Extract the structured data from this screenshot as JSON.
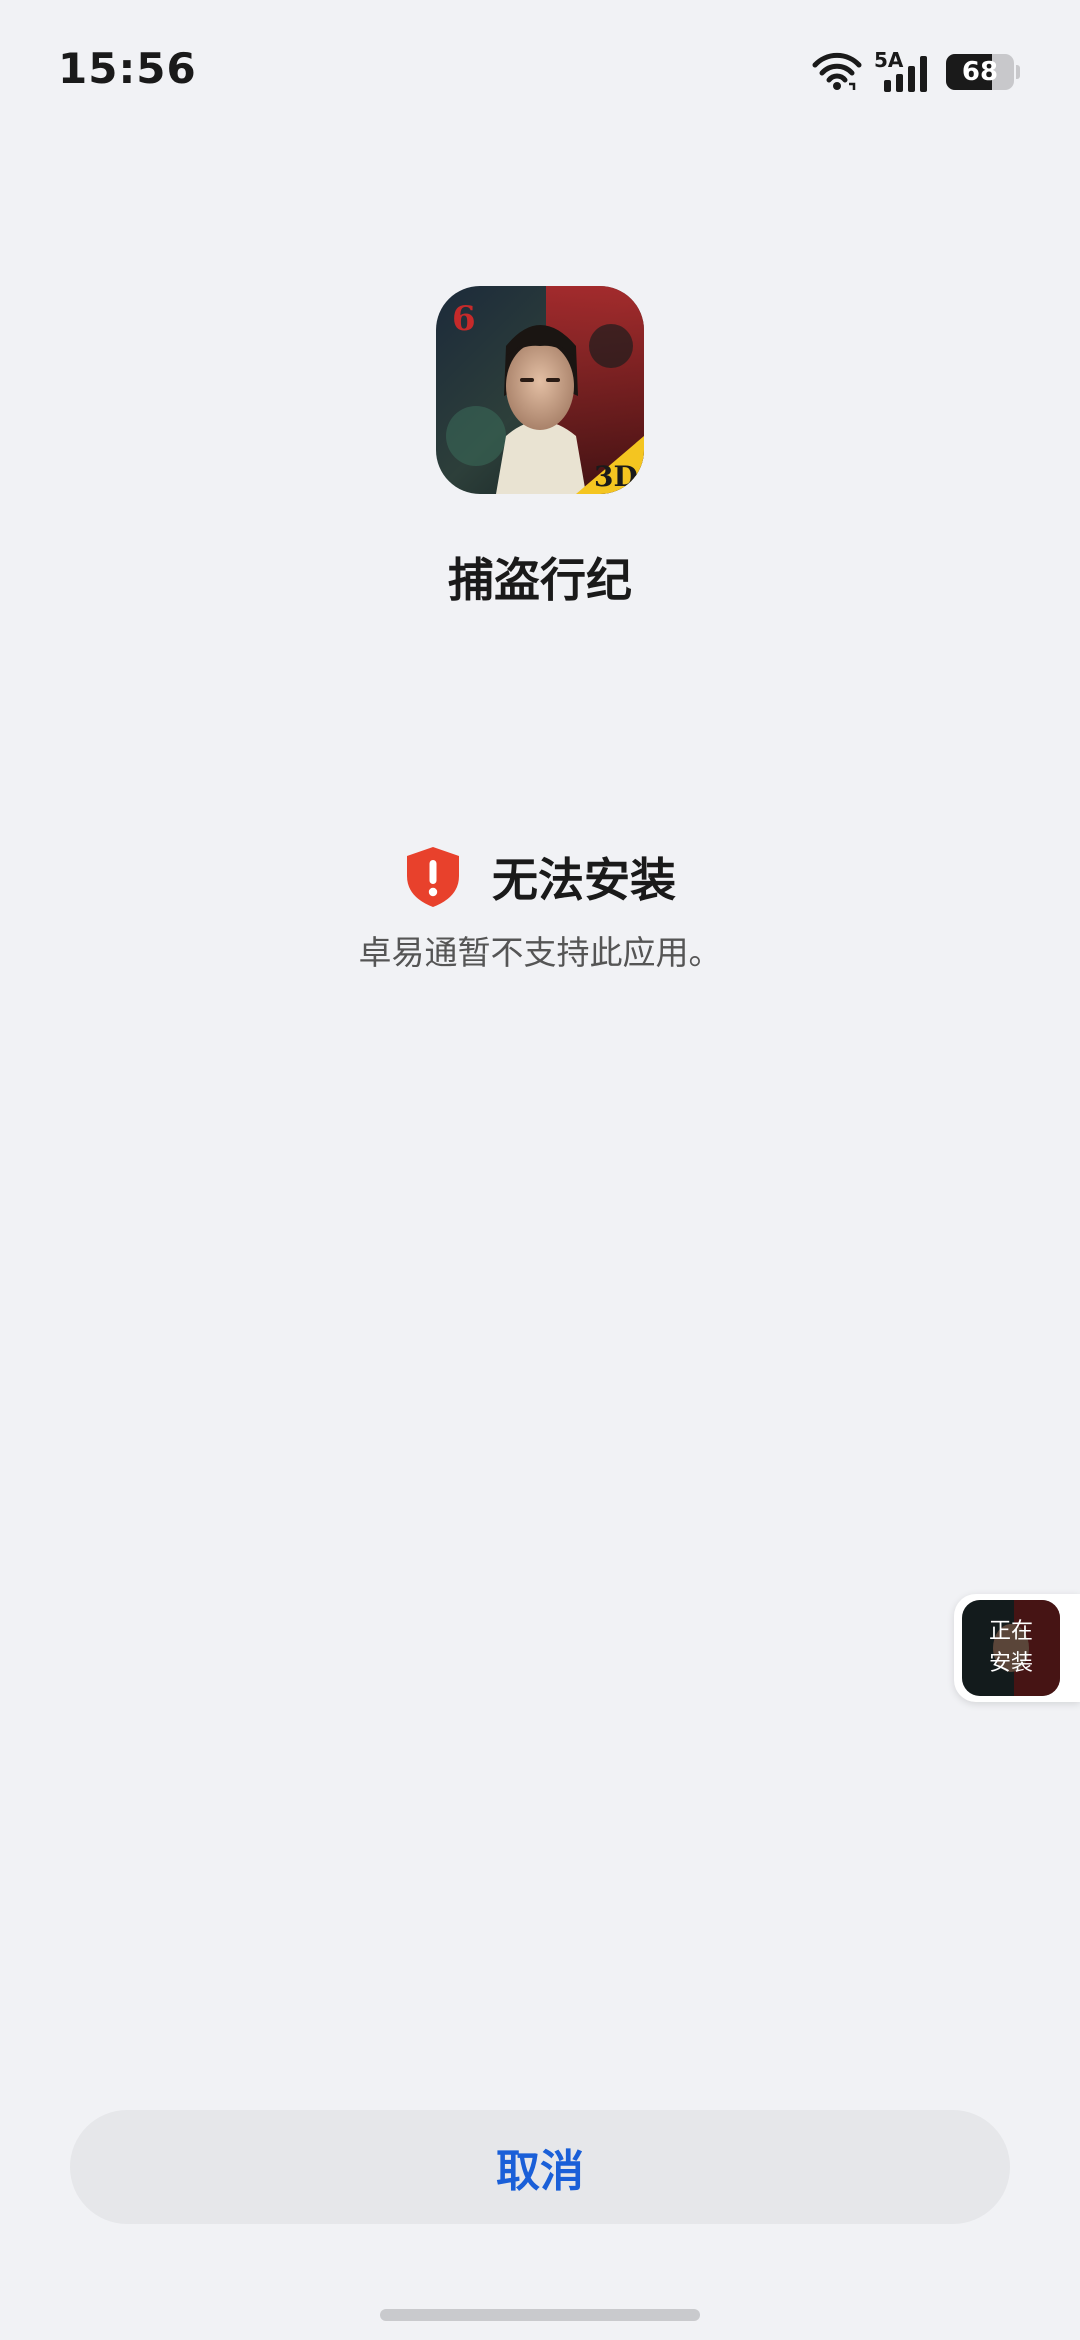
{
  "status_bar": {
    "time": "15:56",
    "network_label": "5A",
    "battery_level": "68",
    "battery_fraction": 0.68,
    "icons": [
      "wifi-icon",
      "signal-icon",
      "battery-icon"
    ]
  },
  "app": {
    "name": "捕盗行纪",
    "icon_badges": {
      "top_left": "6",
      "bottom_right": "3D"
    }
  },
  "install_error": {
    "icon": "shield-alert-icon",
    "title": "无法安装",
    "message": "卓易通暂不支持此应用。"
  },
  "install_bubble": {
    "line1": "正在",
    "line2": "安装"
  },
  "actions": {
    "cancel_label": "取消"
  },
  "colors": {
    "background": "#f1f2f5",
    "accent": "#1a5fd8",
    "warning": "#e8412c",
    "button_bg": "#e6e7ea"
  }
}
